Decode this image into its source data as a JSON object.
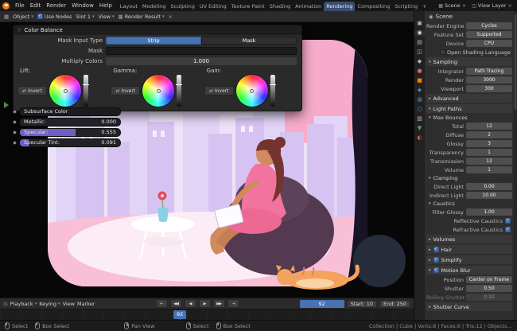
{
  "icons": {
    "dropdown": "▾",
    "collapse_open": "▾",
    "collapse_closed": "▸",
    "check": "✓",
    "close": "×",
    "editor_image": "▦",
    "editor_timeline": "◷",
    "scene_chip": "▦",
    "view_layer_chip": "◫",
    "breadcrumb_scene": "◉",
    "invert": "⇄",
    "panel_grip": "⠿"
  },
  "colors": {
    "accent": "#4772b3",
    "active_tab": "#3a4d71",
    "object_orange": "#e87d0d"
  },
  "topbar": {
    "menus": [
      "File",
      "Edit",
      "Render",
      "Window",
      "Help"
    ],
    "tabs": [
      {
        "label": "Layout"
      },
      {
        "label": "Modeling"
      },
      {
        "label": "Sculpting"
      },
      {
        "label": "UV Editing"
      },
      {
        "label": "Texture Paint"
      },
      {
        "label": "Shading"
      },
      {
        "label": "Animation"
      },
      {
        "label": "Rendering"
      },
      {
        "label": "Compositing"
      },
      {
        "label": "Scripting"
      },
      {
        "label": "+"
      }
    ],
    "scene_label": "Scene",
    "view_layer_label": "View Layer"
  },
  "editor_header": {
    "mode_label": "Object",
    "use_nodes_label": "Use Nodes",
    "slot_label": "Slot 1",
    "view_label": "View",
    "image_label": "Render Result"
  },
  "color_balance": {
    "title": "Color Balance",
    "mask_input_type_label": "Mask Input Type",
    "strip_option": "Strip",
    "mask_option": "Mask",
    "mask_field_label": "Mask",
    "multiply_label": "Multiply Colors",
    "multiply_value": "1.000",
    "lift_label": "Lift:",
    "gamma_label": "Gamma:",
    "gain_label": "Gain:",
    "invert_label": "Invert"
  },
  "material_props": {
    "rows": [
      {
        "label": "Subsurface Color",
        "value": "",
        "fill": 0
      },
      {
        "label": "Metallic:",
        "value": "0.000",
        "fill": 0
      },
      {
        "label": "Specular:",
        "value": "0.555",
        "fill": 0.555
      },
      {
        "label": "Specular Tint:",
        "value": "0.091",
        "fill": 0.091
      }
    ]
  },
  "properties": {
    "breadcrumb": "Scene",
    "tabs": [
      {
        "name": "tool-tab",
        "glyph": "▣",
        "color": "#b8b8b8"
      },
      {
        "name": "render-tab",
        "glyph": "◉",
        "color": "#e0e0e0"
      },
      {
        "name": "output-tab",
        "glyph": "▤",
        "color": "#b8b8b8"
      },
      {
        "name": "view-layer-tab",
        "glyph": "◫",
        "color": "#b8b8b8"
      },
      {
        "name": "scene-tab",
        "glyph": "◆",
        "color": "#b8b8b8"
      },
      {
        "name": "world-tab",
        "glyph": "●",
        "color": "#cf6a5e"
      },
      {
        "name": "object-tab",
        "glyph": "■",
        "color": "#e87d0d"
      },
      {
        "name": "modifiers-tab",
        "glyph": "◈",
        "color": "#6f9fd8"
      },
      {
        "name": "particles-tab",
        "glyph": "◍",
        "color": "#6f9fd8"
      },
      {
        "name": "physics-tab",
        "glyph": "○",
        "color": "#6f9fd8"
      },
      {
        "name": "constraints-tab",
        "glyph": "▥",
        "color": "#b8b8b8"
      },
      {
        "name": "object-data-tab",
        "glyph": "▼",
        "color": "#57a557"
      },
      {
        "name": "material-tab",
        "glyph": "◐",
        "color": "#cf5e5e"
      }
    ],
    "render_engine_label": "Render Engine",
    "render_engine_value": "Cycles",
    "feature_set_label": "Feature Set",
    "feature_set_value": "Supported",
    "device_label": "Device",
    "device_value": "CPU",
    "osl_label": "Open Shading Language",
    "sampling_title": "Sampling",
    "integrator_label": "Integrator",
    "integrator_value": "Path Tracing",
    "render_samples_label": "Render",
    "render_samples_value": "3000",
    "viewport_samples_label": "Viewport",
    "viewport_samples_value": "300",
    "advanced_title": "Advanced",
    "light_paths_title": "Light Paths",
    "max_bounces_title": "Max Bounces",
    "total_label": "Total",
    "total_value": "12",
    "diffuse_label": "Diffuse",
    "diffuse_value": "2",
    "glossy_label": "Glossy",
    "glossy_value": "3",
    "transparency_label": "Transparency",
    "transparency_value": "1",
    "transmission_label": "Transmission",
    "transmission_value": "12",
    "volume_label": "Volume",
    "volume_value": "1",
    "clamping_title": "Clamping",
    "direct_light_label": "Direct Light",
    "direct_light_value": "0.00",
    "indirect_light_label": "Indirect Light",
    "indirect_light_value": "10.00",
    "caustics_title": "Caustics",
    "filter_glossy_label": "Filter Glossy",
    "filter_glossy_value": "1.00",
    "reflective_label": "Reflective Caustics",
    "refractive_label": "Refractive Caustics",
    "volumes_title": "Volumes",
    "hair_title": "Hair",
    "simplify_title": "Simplify",
    "motion_blur_title": "Motion Blur",
    "position_label": "Position",
    "position_value": "Center on Frame",
    "shutter_label": "Shutter",
    "shutter_value": "0.50",
    "rolling_label": "Rolling Shutter Dur..",
    "rolling_value": "0.10",
    "shutter_curve_title": "Shutter Curve"
  },
  "timeline": {
    "playback_label": "Playback",
    "keying_label": "Keying",
    "view_label": "View",
    "marker_label": "Marker",
    "transport": [
      {
        "name": "jump-to-start",
        "glyph": "⇤"
      },
      {
        "name": "prev-keyframe",
        "glyph": "◀◀"
      },
      {
        "name": "play-reverse",
        "glyph": "◀"
      },
      {
        "name": "play",
        "glyph": "▶"
      },
      {
        "name": "next-keyframe",
        "glyph": "▶▶"
      },
      {
        "name": "jump-to-end",
        "glyph": "⇥"
      }
    ],
    "current_frame": "92",
    "start_label": "Start:",
    "start_value": "10",
    "end_label": "End:",
    "end_value": "250",
    "playhead_frame": "92"
  },
  "statusbar": {
    "hints": [
      {
        "label": "Select"
      },
      {
        "label": "Box Select"
      },
      {
        "label": "Pan View"
      },
      {
        "label": "Select"
      },
      {
        "label": "Box Select"
      }
    ],
    "stats": "Collection | Cube | Verts:8 | Faces:6 | Tris:12 | Objects…"
  }
}
